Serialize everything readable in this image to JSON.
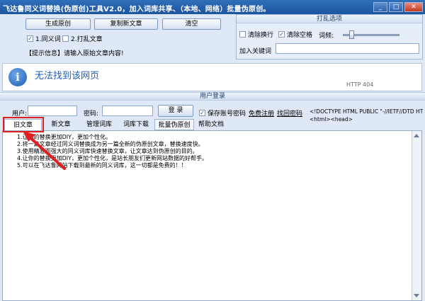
{
  "window": {
    "title": "飞达鲁同义词替换(伪原创)工具V2.0，加入词库共享、（本地、网络）批量伪原创。",
    "min_label": "_",
    "max_label": "□",
    "close_label": "✕"
  },
  "toolbar": {
    "generate_label": "生成原创",
    "copy_label": "复制新文章",
    "clear_label": "清空",
    "synonym_check": "1.同义词",
    "shuffle_check": "2.打乱文章",
    "hint": "【提示信息】请输入原始文章内容!"
  },
  "shuffle_options": {
    "title": "打乱选项",
    "remove_newline": "清除换行",
    "remove_space": "清除空格",
    "frequency_label": "词频:",
    "keyword_label": "加入关键词",
    "keyword_value": ""
  },
  "browser": {
    "message": "无法找到该网页",
    "status": "HTTP 404",
    "icon": "info-icon"
  },
  "login": {
    "section_title": "用户登录",
    "username_label": "用户:",
    "username_value": "",
    "password_label": "密码:",
    "password_value": "",
    "login_button": "登 录",
    "save_password": "保存账号密码",
    "register_link": "免费注册",
    "forgot_link": "找回密码",
    "source_line1": "<!DOCTYPE HTML PUBLIC \"-//IETF//DTD HTML 2",
    "source_line2": "<html><head>"
  },
  "tabs": [
    "旧文章",
    "新文章",
    "管理词库",
    "词库下载",
    "批量伪原创",
    "帮助文档"
  ],
  "editor": {
    "lines": [
      "1.让你的替换更加DIY，更加个性化。",
      "2.将一篇文章经过同义词替换成为另一篇全新的伪原创文章，替换速度快。",
      "3.使用精准而强大的同义词库快速替换文章，让文章达到伪原创的目的。",
      "4.让你的替换更加DIY，更加个性化，是站长朋友们更新网站数据的好帮手。",
      "5.可以在飞达鲁网站下载到最新的同义词库，这一切都是免费的！！"
    ]
  },
  "colors": {
    "titlebar": "#1d55a0",
    "annotation": "#e02020",
    "accent": "#1f5fb7"
  }
}
